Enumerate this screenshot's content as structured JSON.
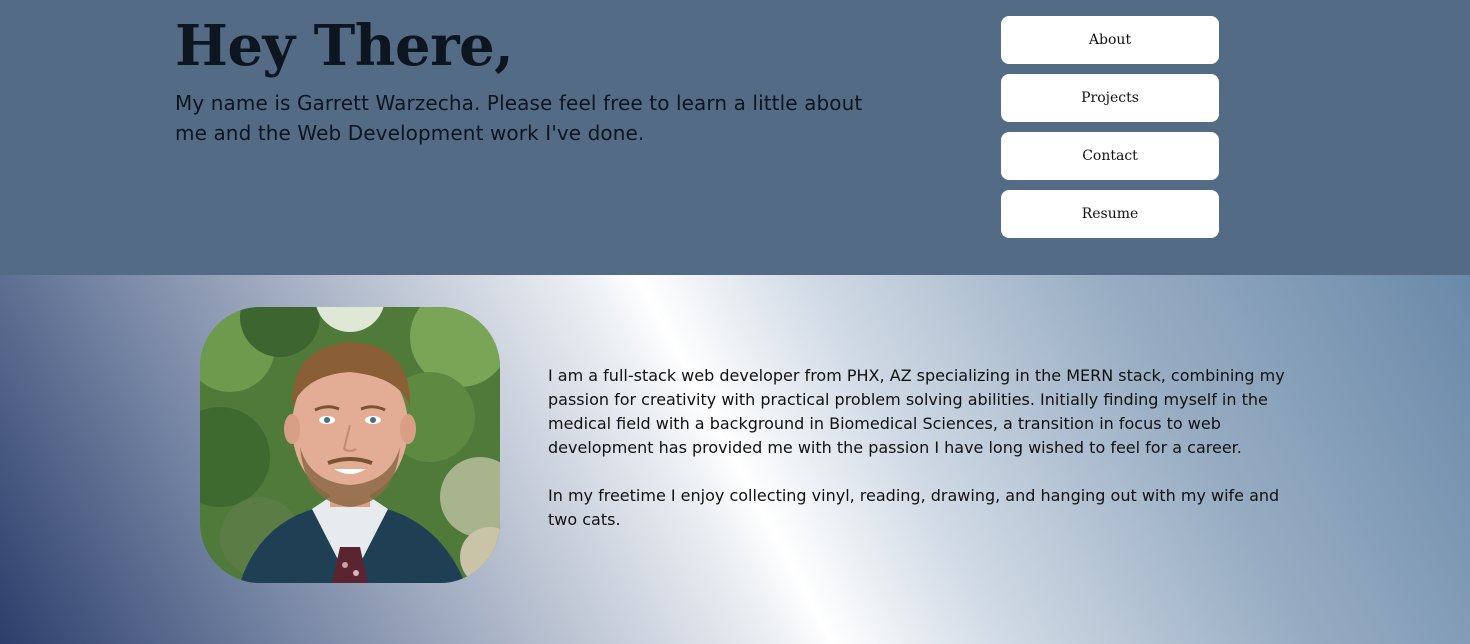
{
  "hero": {
    "title": "Hey There,",
    "intro": "My name is Garrett Warzecha. Please feel free to learn a little about me and the Web Development work I've done."
  },
  "nav": {
    "items": [
      {
        "label": "About"
      },
      {
        "label": "Projects"
      },
      {
        "label": "Contact"
      },
      {
        "label": "Resume"
      }
    ]
  },
  "about": {
    "paragraph_1": "I am a full-stack web developer from PHX, AZ specializing in the MERN stack, combining my passion for creativity with practical problem solving abilities. Initially finding myself in the medical field with a background in Biomedical Sciences, a transition in focus to web development has provided me with the passion I have long wished to feel for a career.",
    "paragraph_2": "In my freetime I enjoy collecting vinyl, reading, drawing, and hanging out with my wife and two cats."
  },
  "colors": {
    "header_bg": "#546b85",
    "button_bg": "#ffffff",
    "text_dark": "#0d1520"
  }
}
